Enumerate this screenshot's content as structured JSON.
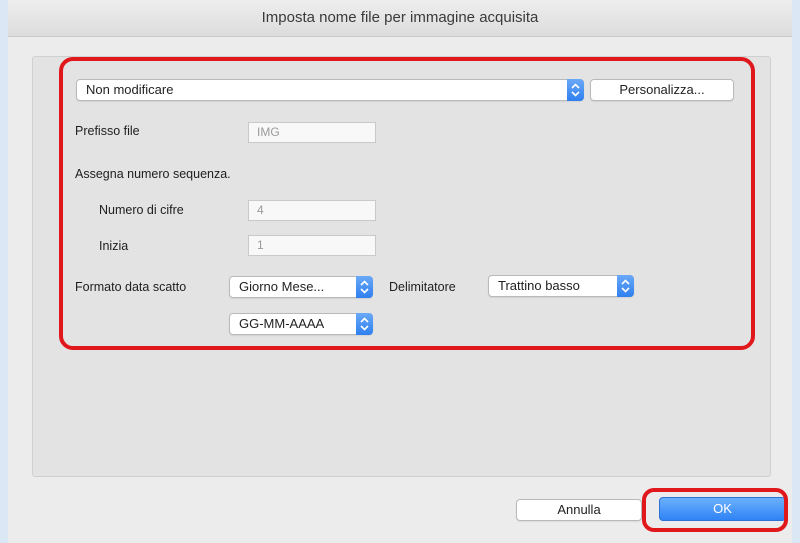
{
  "dialog": {
    "title": "Imposta nome file per immagine acquisita"
  },
  "naming": {
    "mode_selected": "Non modificare",
    "customize_label": "Personalizza..."
  },
  "prefix": {
    "label": "Prefisso file",
    "value": "IMG"
  },
  "sequence": {
    "heading": "Assegna numero sequenza.",
    "digits_label": "Numero di cifre",
    "digits_value": "4",
    "start_label": "Inizia",
    "start_value": "1"
  },
  "date_format": {
    "label": "Formato data scatto",
    "order_selected": "Giorno Mese...",
    "delimiter_label": "Delimitatore",
    "delimiter_selected": "Trattino basso",
    "pattern_selected": "GG-MM-AAAA"
  },
  "footer": {
    "cancel_label": "Annulla",
    "ok_label": "OK"
  },
  "colors": {
    "highlight": "#e0181c",
    "accent": "#2f83f5"
  },
  "icons": {
    "stepper": "updown-arrows-icon"
  }
}
